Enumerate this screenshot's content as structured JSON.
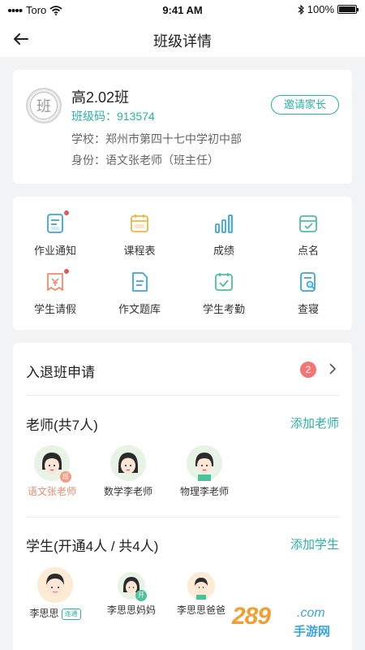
{
  "status_bar": {
    "carrier": "Toro",
    "time": "9:41 AM",
    "battery": "100%"
  },
  "nav": {
    "title": "班级详情"
  },
  "class_info": {
    "avatar_text": "班",
    "name": "高2.02班",
    "code": "班级码：913574",
    "school": "学校：郑州市第四十七中学初中部",
    "role": "身份：语文张老师（班主任）",
    "invite_button": "邀请家长"
  },
  "features": [
    {
      "label": "作业通知",
      "icon": "homework-notice-icon",
      "color": "#3aa6e0",
      "has_dot": true
    },
    {
      "label": "课程表",
      "icon": "schedule-icon",
      "color": "#f2b441",
      "has_dot": false
    },
    {
      "label": "成绩",
      "icon": "grades-chart-icon",
      "color": "#3aa6e0",
      "has_dot": false
    },
    {
      "label": "点名",
      "icon": "roll-call-icon",
      "color": "#4cc19a",
      "has_dot": false
    },
    {
      "label": "学生请假",
      "icon": "leave-request-icon",
      "color": "#f08a6f",
      "has_dot": true
    },
    {
      "label": "作文题库",
      "icon": "essay-bank-icon",
      "color": "#3aa6e0",
      "has_dot": false
    },
    {
      "label": "学生考勤",
      "icon": "attendance-icon",
      "color": "#4cc19a",
      "has_dot": false
    },
    {
      "label": "查寝",
      "icon": "dorm-check-icon",
      "color": "#3aa6e0",
      "has_dot": false
    }
  ],
  "apply": {
    "label": "入退班申请",
    "count": "2"
  },
  "teachers": {
    "title": "老师(共7人)",
    "action": "添加老师",
    "items": [
      {
        "name": "语文张老师",
        "badge": "班",
        "active": true
      },
      {
        "name": "数学李老师",
        "badge": "",
        "active": false
      },
      {
        "name": "物理李老师",
        "badge": "",
        "active": false
      }
    ]
  },
  "students": {
    "title": "学生(开通4人 / 共4人)",
    "action": "添加学生",
    "items": [
      {
        "name": "李思思",
        "tag": "连通"
      },
      {
        "name": "李思思妈妈",
        "badge": "开"
      },
      {
        "name": "李思思爸爸"
      }
    ]
  },
  "watermark": {
    "number": "289",
    "domain": ".com",
    "text": "手游网"
  },
  "colors": {
    "accent": "#27b3a8",
    "badge_red": "#f37575"
  }
}
